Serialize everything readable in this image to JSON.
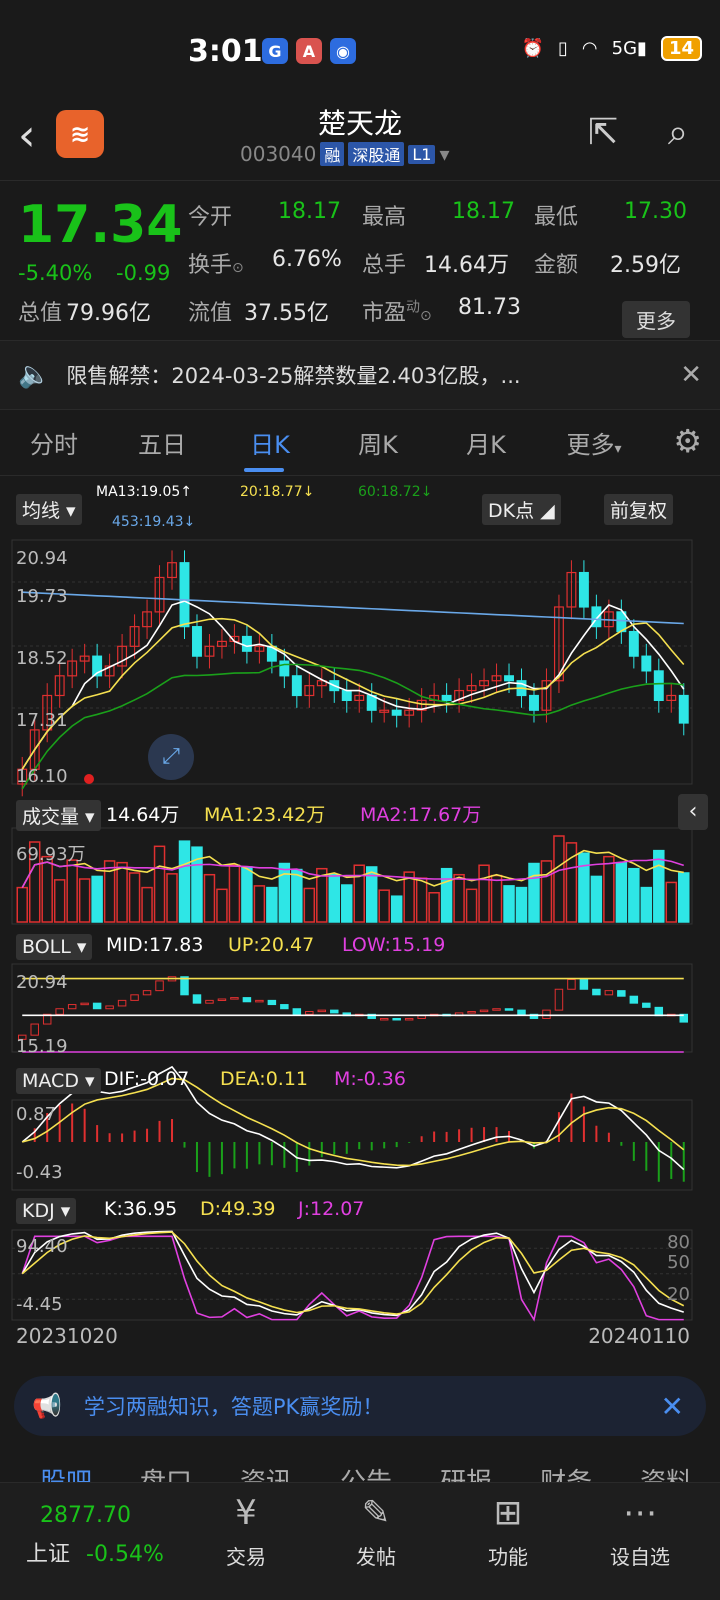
{
  "status": {
    "time": "3:01",
    "battery": "14",
    "network": "5G"
  },
  "header": {
    "title": "楚天龙",
    "code": "003040",
    "tags": [
      "融",
      "深股通",
      "L1"
    ]
  },
  "quote": {
    "price": "17.34",
    "pct": "-5.40%",
    "change": "-0.99",
    "items": [
      {
        "label": "今开",
        "value": "18.17"
      },
      {
        "label": "最高",
        "value": "18.17"
      },
      {
        "label": "最低",
        "value": "17.30"
      },
      {
        "label": "换手",
        "value": "6.76%"
      },
      {
        "label": "总手",
        "value": "14.64万"
      },
      {
        "label": "金额",
        "value": "2.59亿"
      },
      {
        "label": "总值",
        "value": "79.96亿"
      },
      {
        "label": "流值",
        "value": "37.55亿"
      },
      {
        "label": "市盈",
        "value": "81.73"
      }
    ],
    "pe_sup": "动",
    "more": "更多"
  },
  "notice": {
    "text": "限售解禁：2024-03-25解禁数量2.403亿股，..."
  },
  "tabs": [
    "分时",
    "五日",
    "日K",
    "周K",
    "月K",
    "更多"
  ],
  "active_tab": 2,
  "chart": {
    "ma_btn": "均线",
    "ma13": "MA13:19.05↑",
    "ma20": "20:18.77↓",
    "ma60": "60:18.72↓",
    "ma453": "453:19.43↓",
    "dk_btn": "DK点",
    "fq_btn": "前复权",
    "y_labels": [
      "20.94",
      "19.73",
      "18.52",
      "17.31",
      "16.10"
    ],
    "vol_btn": "成交量",
    "vol_val": "14.64万",
    "vol_ma1": "MA1:23.42万",
    "vol_ma2": "MA2:17.67万",
    "vol_max": "69.93万",
    "boll_btn": "BOLL",
    "boll_mid": "MID:17.83",
    "boll_up": "UP:20.47",
    "boll_low": "LOW:15.19",
    "boll_hi_lbl": "20.94",
    "boll_lo_lbl": "15.19",
    "macd_btn": "MACD",
    "macd_dif": "DIF:-0.07",
    "macd_dea": "DEA:0.11",
    "macd_m": "M:-0.36",
    "macd_hi": "0.87",
    "macd_lo": "-0.43",
    "kdj_btn": "KDJ",
    "kdj_k": "K:36.95",
    "kdj_d": "D:49.39",
    "kdj_j": "J:12.07",
    "kdj_hi": "94.40",
    "kdj_lo": "-4.45",
    "kdj_80": "80",
    "kdj_50": "50",
    "kdj_20": "20",
    "date_start": "20231020",
    "date_end": "20240110"
  },
  "chart_data": {
    "type": "candlestick",
    "x_range": [
      "20231020",
      "20240110"
    ],
    "ylim": [
      16.1,
      20.94
    ],
    "close": [
      16.4,
      17.2,
      17.9,
      18.3,
      18.6,
      18.7,
      18.3,
      18.5,
      18.9,
      19.3,
      19.6,
      20.3,
      20.6,
      19.3,
      18.7,
      18.9,
      19.0,
      19.1,
      18.8,
      18.9,
      18.6,
      18.3,
      17.9,
      18.1,
      18.2,
      18.0,
      17.8,
      17.9,
      17.6,
      17.6,
      17.5,
      17.6,
      17.8,
      17.9,
      17.8,
      18.0,
      18.1,
      18.2,
      18.3,
      18.2,
      17.9,
      17.6,
      18.2,
      19.7,
      20.4,
      19.7,
      19.3,
      19.6,
      19.2,
      18.7,
      18.4,
      17.8,
      17.9,
      17.34
    ],
    "volume_unit": "万",
    "volume_max": 69.93,
    "colors": {
      "up": "#e03030",
      "down": "#2ee6e6",
      "ma13": "#ffffff",
      "ma20": "#f5e050",
      "ma60": "#1aa01a",
      "ma453": "#6aa8e8"
    }
  },
  "subtabs": [
    "股吧",
    "盘口",
    "资讯",
    "公告",
    "研报",
    "财务",
    "资料"
  ],
  "banner": {
    "text": "学习两融知识，答题PK赢奖励！"
  },
  "bottom": {
    "index_value": "2877.70",
    "index_name": "上证",
    "index_pct": "-0.54%",
    "nav": [
      "交易",
      "发帖",
      "功能",
      "设自选"
    ]
  }
}
